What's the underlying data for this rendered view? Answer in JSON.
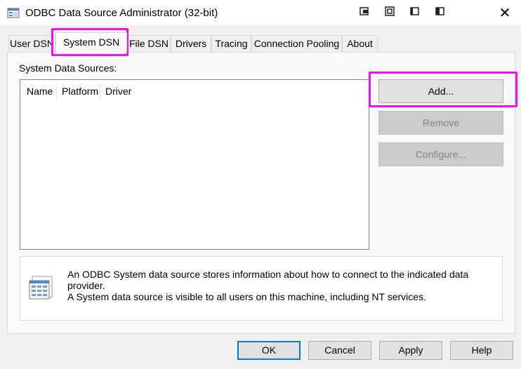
{
  "window": {
    "title": "ODBC Data Source Administrator (32-bit)",
    "app_icon": "odbc-app-icon",
    "close_glyph": "✕",
    "tray_icons": [
      "toolbar-icon-1",
      "toolbar-icon-2",
      "toolbar-icon-3",
      "toolbar-icon-4"
    ]
  },
  "tabs": [
    {
      "label": "User DSN",
      "active": false
    },
    {
      "label": "System DSN",
      "active": true
    },
    {
      "label": "File DSN",
      "active": false
    },
    {
      "label": "Drivers",
      "active": false
    },
    {
      "label": "Tracing",
      "active": false
    },
    {
      "label": "Connection Pooling",
      "active": false
    },
    {
      "label": "About",
      "active": false
    }
  ],
  "system_dsn": {
    "section_label": "System Data Sources:",
    "columns": [
      "Name",
      "Platform",
      "Driver"
    ],
    "rows": [],
    "buttons": {
      "add": {
        "label": "Add...",
        "enabled": true
      },
      "remove": {
        "label": "Remove",
        "enabled": false
      },
      "configure": {
        "label": "Configure...",
        "enabled": false
      }
    },
    "info": {
      "icon": "data-source-icon",
      "line1": "An ODBC System data source stores information about how to connect to the indicated data provider.",
      "line2": "A System data source is visible to all users on this machine, including NT services."
    }
  },
  "footer": {
    "ok": "OK",
    "cancel": "Cancel",
    "apply": "Apply",
    "help": "Help"
  },
  "colors": {
    "highlight": "#ee11ee",
    "default_button_border": "#0078d7",
    "dialog_background": "#f0f0f0"
  }
}
